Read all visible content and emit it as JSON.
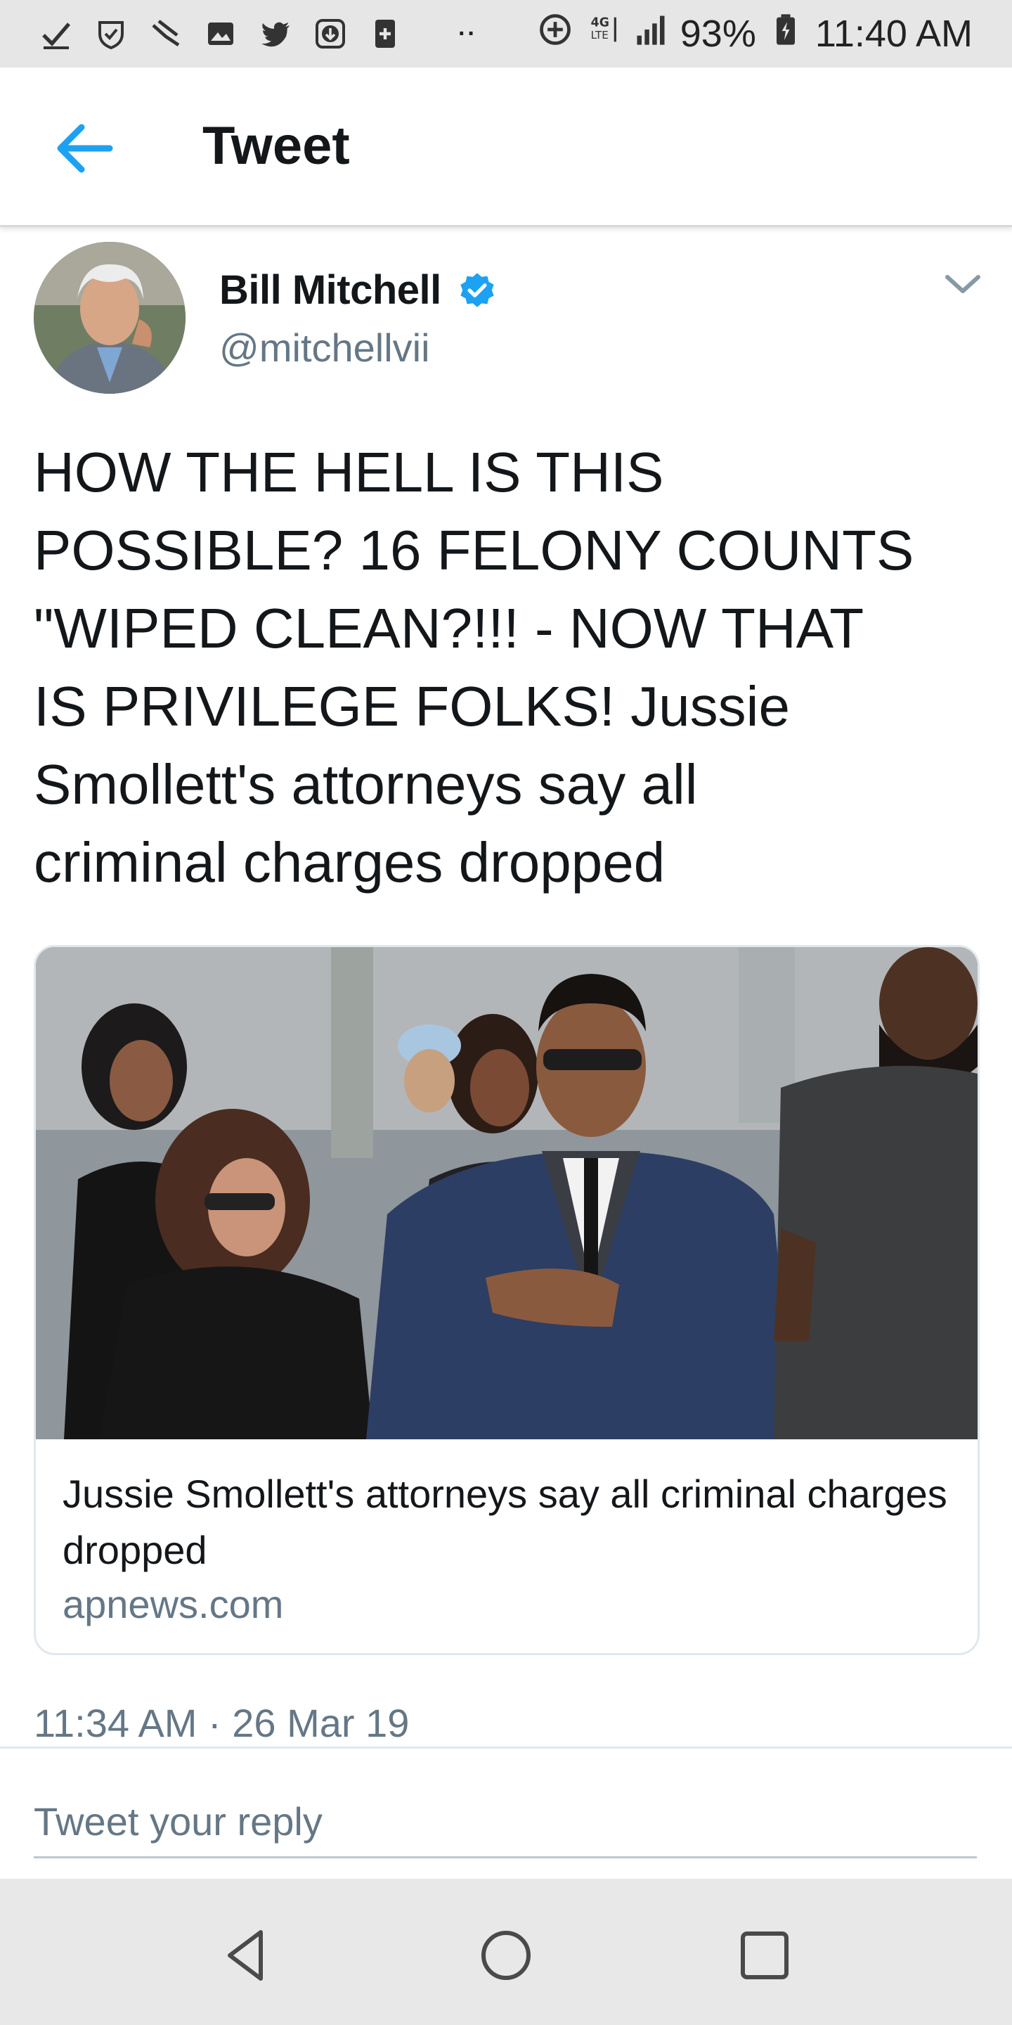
{
  "status_bar": {
    "battery": "93%",
    "time": "11:40 AM",
    "network": "4G LTE",
    "icons_left": [
      "check-icon",
      "shield-icon",
      "missed-call-icon",
      "image-icon",
      "twitter-icon",
      "download-icon",
      "plus-box-icon"
    ],
    "icons_right": [
      "data-saver-icon",
      "network-icon",
      "signal-icon",
      "battery-icon"
    ]
  },
  "app_bar": {
    "title": "Tweet",
    "back_icon": "back-arrow-icon"
  },
  "tweet": {
    "author_name": "Bill Mitchell",
    "author_handle": "@mitchellvii",
    "verified": true,
    "text": "HOW THE HELL IS THIS\nPOSSIBLE? 16 FELONY COUNTS\n\"WIPED CLEAN?!!! - NOW THAT\nIS PRIVILEGE FOLKS! Jussie\nSmollett's attorneys say all\ncriminal charges dropped",
    "timestamp": "11:34 AM · 26 Mar 19",
    "card": {
      "title": "Jussie Smollett's attorneys say all criminal charges dropped",
      "domain": "apnews.com"
    }
  },
  "reply": {
    "placeholder": "Tweet your reply"
  },
  "colors": {
    "accent": "#1da1f2",
    "secondary_text": "#657786",
    "border": "#e1e8ed"
  },
  "nav_bar": {
    "icons": [
      "back-triangle-icon",
      "home-circle-icon",
      "recents-square-icon"
    ]
  }
}
